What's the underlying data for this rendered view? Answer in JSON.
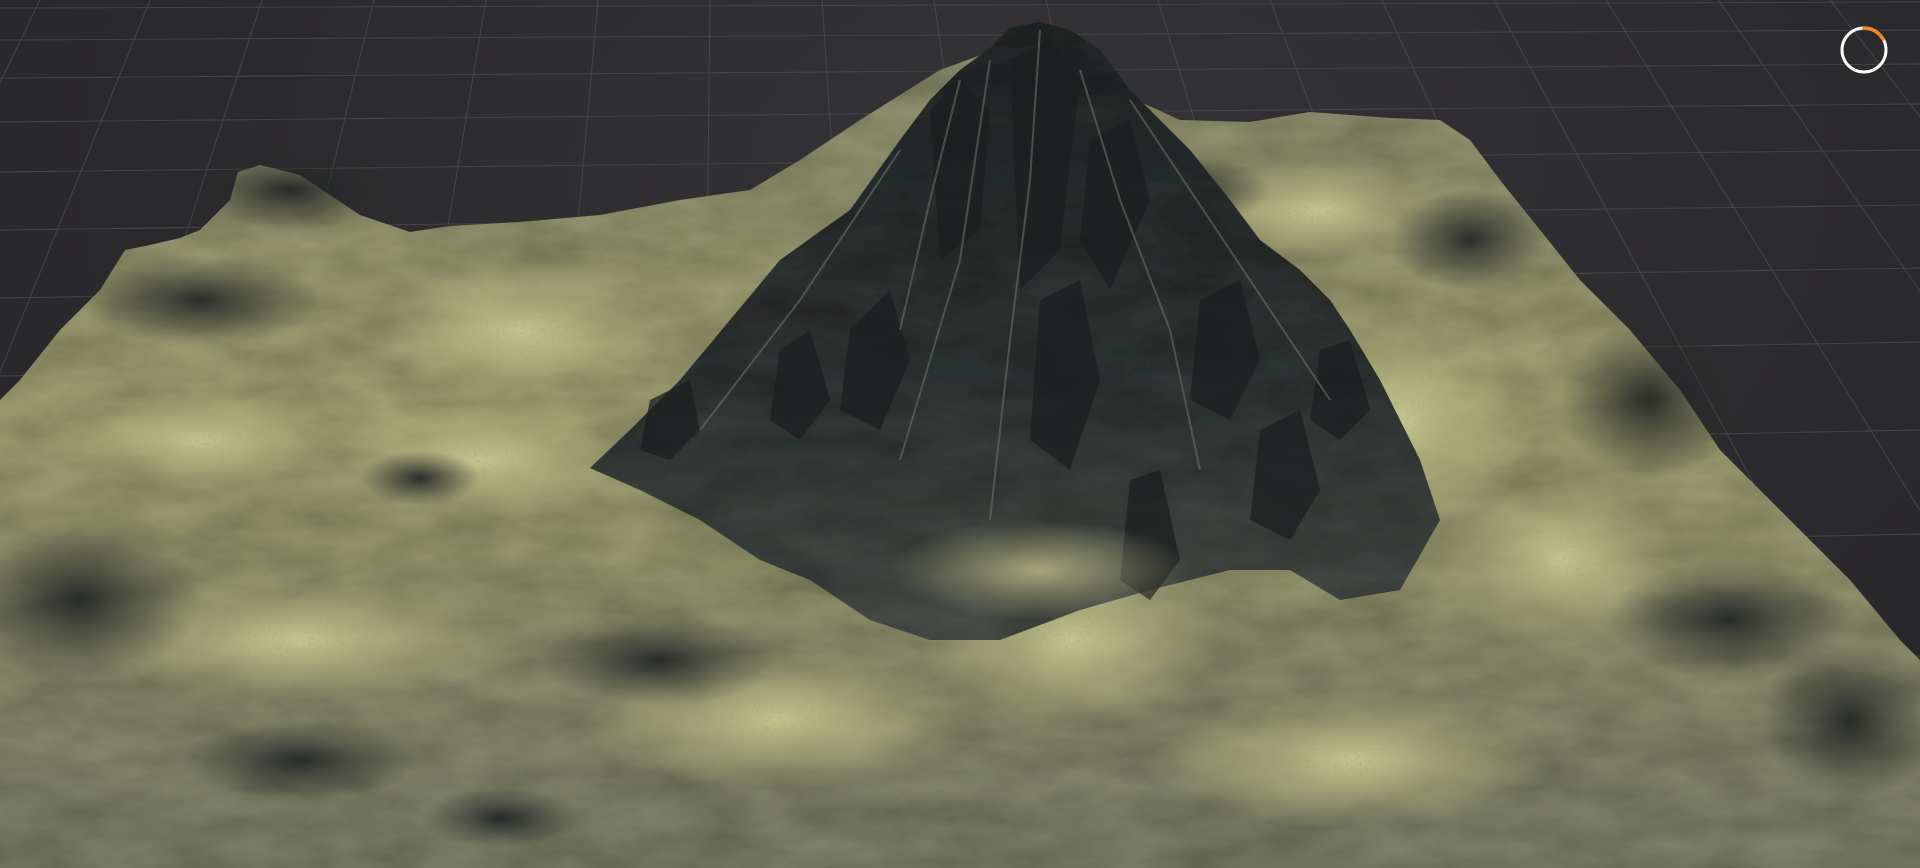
{
  "viewport": {
    "background_color": "#2b2a2c",
    "grid_color": "#4a494c",
    "terrain_colors": {
      "rock_dark": "#2a2d2d",
      "rock_mid": "#4d514f",
      "rock_light": "#7a7f79",
      "grass_light": "#c7c48e",
      "grass_mid": "#a5a672",
      "grass_dark": "#6e7050"
    }
  },
  "loading_indicator": {
    "icon": "loading-spinner-icon",
    "ring_color": "#ffffff",
    "accent_color": "#f08a24"
  }
}
